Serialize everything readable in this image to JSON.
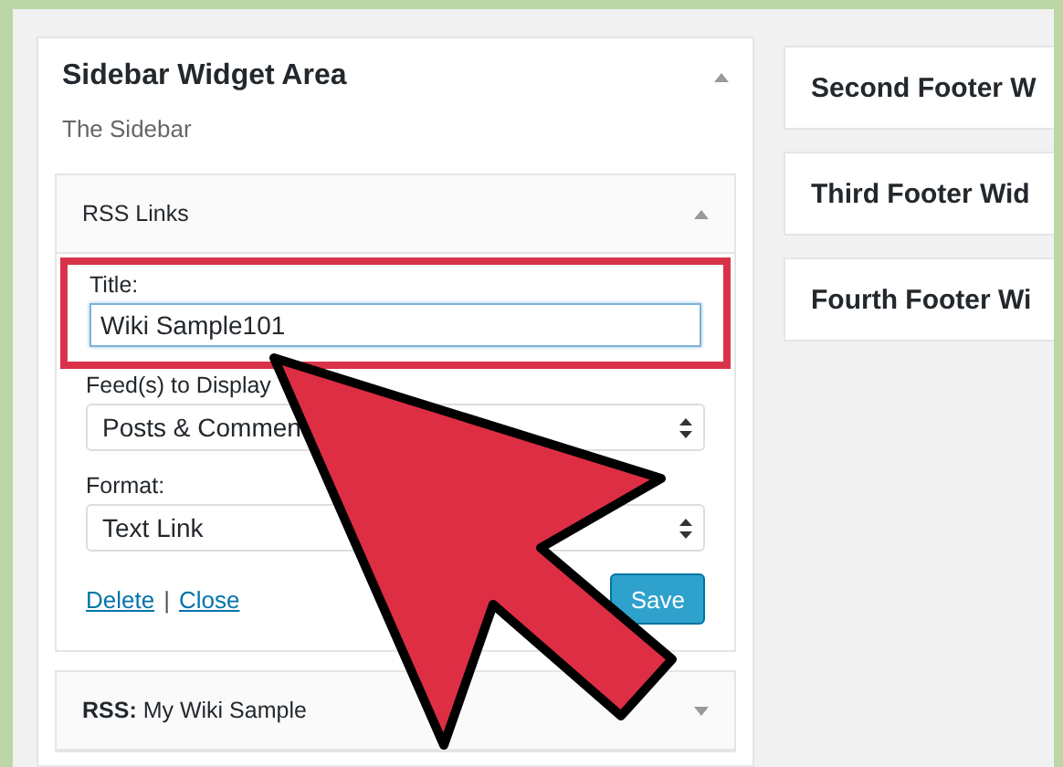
{
  "sidebar_area": {
    "title": "Sidebar Widget Area",
    "expanded": true,
    "description": "The Sidebar",
    "widgets": [
      {
        "title": "RSS Links",
        "expanded": true,
        "form": {
          "title_label": "Title:",
          "title_value": "Wiki Sample101",
          "highlighted": true,
          "feeds_label": "Feed(s) to Display",
          "feeds_value": "Posts & Commen",
          "format_label": "Format:",
          "format_value": "Text Link",
          "delete_link": "Delete",
          "separator": "|",
          "close_link": "Close",
          "save_button": "Save"
        }
      },
      {
        "title": "**RSS:** My Wiki Sample",
        "expanded": false
      }
    ]
  },
  "footer_areas": [
    {
      "title": "Second Footer W"
    },
    {
      "title": "Third Footer Wid"
    },
    {
      "title": "Fourth Footer Wi"
    }
  ]
}
